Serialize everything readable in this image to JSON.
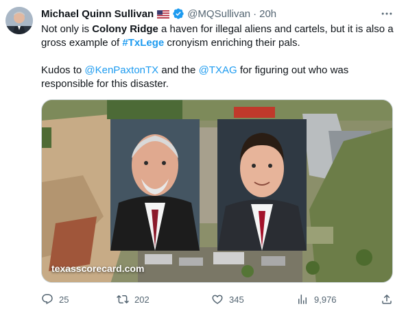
{
  "author": {
    "name": "Michael Quinn Sullivan",
    "handle": "@MQSullivan",
    "separator": "·",
    "time": "20h"
  },
  "tweet": {
    "p1_a": "Not only is ",
    "p1_b": "Colony Ridge",
    "p1_c": " a haven for illegal aliens and cartels, but it is also a gross example of ",
    "p1_hashtag": "#TxLege",
    "p1_d": " cronyism enriching their pals.",
    "p2_a": "Kudos to ",
    "p2_m1": "@KenPaxtonTX",
    "p2_b": " and the ",
    "p2_m2": "@TXAG",
    "p2_c": " for figuring out who was responsible for this disaster."
  },
  "media": {
    "watermark": "texasscorecard.com"
  },
  "stats": {
    "replies": "25",
    "reposts": "202",
    "likes": "345",
    "views": "9,976"
  },
  "icons": {
    "flag": "us-flag-icon",
    "verified": "verified-badge-icon",
    "more": "more-icon",
    "reply": "reply-icon",
    "repost": "repost-icon",
    "like": "heart-icon",
    "views": "views-icon",
    "share": "share-icon"
  },
  "colors": {
    "link": "#1d9bf0",
    "muted": "#536471",
    "text": "#0f1419"
  }
}
